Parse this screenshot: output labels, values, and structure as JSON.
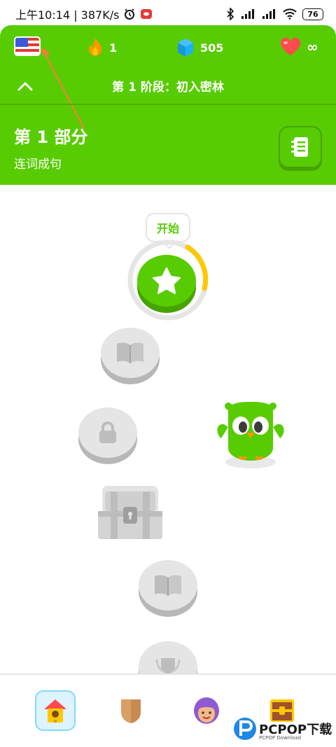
{
  "status_bar": {
    "time_speed": "上午10:14 | 387K/s",
    "battery": "76"
  },
  "header": {
    "streak_count": "1",
    "gems_count": "505",
    "hearts": "∞",
    "section_title": "第 1 阶段：初入密林",
    "unit_title": "第 1 部分",
    "unit_subtitle": "连词成句"
  },
  "path": {
    "start_tooltip": "开始",
    "nodes": [
      "star-icon",
      "book-icon",
      "lock-icon",
      "chest-icon",
      "book-icon",
      "trophy-icon"
    ]
  },
  "bottom_nav": {
    "tabs": [
      "home-icon",
      "shield-icon",
      "profile-icon",
      "chest-icon"
    ]
  },
  "watermark": {
    "brand": "PCPOP下载",
    "small": "PCPOP Download"
  },
  "colors": {
    "brand_green": "#58cc02",
    "green_shadow": "#46a302",
    "gem_blue": "#1cb0f6",
    "heart_red": "#ff4b4b",
    "fire_orange": "#ff9600",
    "locked_gray": "#e5e5e5"
  }
}
